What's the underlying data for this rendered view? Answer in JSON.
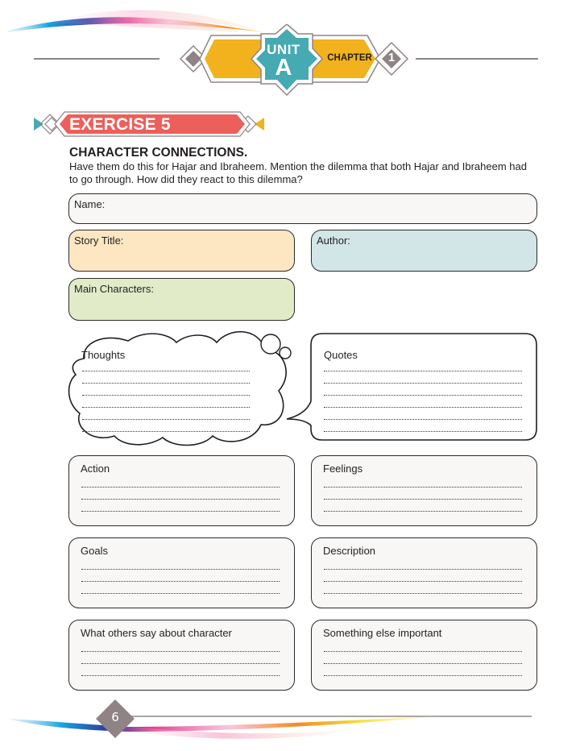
{
  "header": {
    "unit_label": "UNIT",
    "unit_letter": "A",
    "chapter_label": "CHAPTER",
    "chapter_number": "1"
  },
  "exercise": {
    "title": "EXERCISE 5"
  },
  "section": {
    "title": "CHARACTER CONNECTIONS.",
    "instructions": "Have them do this for Hajar and Ibraheem. Mention the dilemma that both Hajar and Ibraheem had to go through. How did they react to this dilemma?"
  },
  "fields": {
    "name": "Name:",
    "story_title": "Story Title:",
    "author": "Author:",
    "main_characters": "Main Characters:"
  },
  "thoughts": {
    "label": "Thoughts",
    "lines": 6
  },
  "quotes": {
    "label": "Quotes",
    "lines": 6
  },
  "cards": [
    {
      "label": "Action",
      "lines": 3
    },
    {
      "label": "Feelings",
      "lines": 3
    },
    {
      "label": "Goals",
      "lines": 3
    },
    {
      "label": "Description",
      "lines": 3
    },
    {
      "label": "What others say about character",
      "lines": 3
    },
    {
      "label": "Something else important",
      "lines": 3
    }
  ],
  "footer": {
    "page_number": "6"
  },
  "colors": {
    "gold": "#f2b21d",
    "teal": "#45aab2",
    "coral": "#ec5f5a",
    "taupe": "#8f8385",
    "story_title_fill": "#fde7c2",
    "author_fill": "#d2e5e7",
    "main_characters_fill": "#e1ebc8"
  }
}
